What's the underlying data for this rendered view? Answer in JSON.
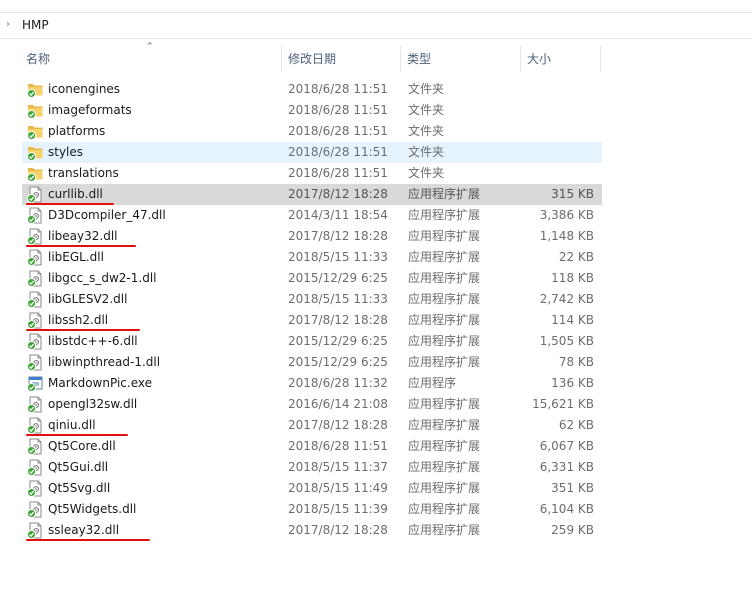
{
  "breadcrumb": {
    "chevron": "chevron-right-icon",
    "path": "HMP"
  },
  "columns": {
    "name": "名称",
    "date": "修改日期",
    "type": "类型",
    "size": "大小"
  },
  "sort": {
    "column": "name",
    "direction": "ascending"
  },
  "files": [
    {
      "name": "iconengines",
      "date": "2018/6/28 11:51",
      "type": "文件夹",
      "size": "",
      "icon": "folder-icon"
    },
    {
      "name": "imageformats",
      "date": "2018/6/28 11:51",
      "type": "文件夹",
      "size": "",
      "icon": "folder-icon"
    },
    {
      "name": "platforms",
      "date": "2018/6/28 11:51",
      "type": "文件夹",
      "size": "",
      "icon": "folder-icon"
    },
    {
      "name": "styles",
      "date": "2018/6/28 11:51",
      "type": "文件夹",
      "size": "",
      "icon": "folder-icon",
      "state": "hover"
    },
    {
      "name": "translations",
      "date": "2018/6/28 11:51",
      "type": "文件夹",
      "size": "",
      "icon": "folder-icon"
    },
    {
      "name": "curllib.dll",
      "date": "2017/8/12 18:28",
      "type": "应用程序扩展",
      "size": "315 KB",
      "icon": "dll-icon",
      "state": "selected",
      "underlined": true
    },
    {
      "name": "D3Dcompiler_47.dll",
      "date": "2014/3/11 18:54",
      "type": "应用程序扩展",
      "size": "3,386 KB",
      "icon": "dll-icon"
    },
    {
      "name": "libeay32.dll",
      "date": "2017/8/12 18:28",
      "type": "应用程序扩展",
      "size": "1,148 KB",
      "icon": "dll-icon",
      "underlined": true
    },
    {
      "name": "libEGL.dll",
      "date": "2018/5/15 11:33",
      "type": "应用程序扩展",
      "size": "22 KB",
      "icon": "dll-icon"
    },
    {
      "name": "libgcc_s_dw2-1.dll",
      "date": "2015/12/29 6:25",
      "type": "应用程序扩展",
      "size": "118 KB",
      "icon": "dll-icon"
    },
    {
      "name": "libGLESV2.dll",
      "date": "2018/5/15 11:33",
      "type": "应用程序扩展",
      "size": "2,742 KB",
      "icon": "dll-icon"
    },
    {
      "name": "libssh2.dll",
      "date": "2017/8/12 18:28",
      "type": "应用程序扩展",
      "size": "114 KB",
      "icon": "dll-icon",
      "underlined": true
    },
    {
      "name": "libstdc++-6.dll",
      "date": "2015/12/29 6:25",
      "type": "应用程序扩展",
      "size": "1,505 KB",
      "icon": "dll-icon"
    },
    {
      "name": "libwinpthread-1.dll",
      "date": "2015/12/29 6:25",
      "type": "应用程序扩展",
      "size": "78 KB",
      "icon": "dll-icon"
    },
    {
      "name": "MarkdownPic.exe",
      "date": "2018/6/28 11:32",
      "type": "应用程序",
      "size": "136 KB",
      "icon": "exe-icon"
    },
    {
      "name": "opengl32sw.dll",
      "date": "2016/6/14 21:08",
      "type": "应用程序扩展",
      "size": "15,621 KB",
      "icon": "dll-icon"
    },
    {
      "name": "qiniu.dll",
      "date": "2017/8/12 18:28",
      "type": "应用程序扩展",
      "size": "62 KB",
      "icon": "dll-icon",
      "underlined": true
    },
    {
      "name": "Qt5Core.dll",
      "date": "2018/6/28 11:51",
      "type": "应用程序扩展",
      "size": "6,067 KB",
      "icon": "dll-icon"
    },
    {
      "name": "Qt5Gui.dll",
      "date": "2018/5/15 11:37",
      "type": "应用程序扩展",
      "size": "6,331 KB",
      "icon": "dll-icon"
    },
    {
      "name": "Qt5Svg.dll",
      "date": "2018/5/15 11:49",
      "type": "应用程序扩展",
      "size": "351 KB",
      "icon": "dll-icon"
    },
    {
      "name": "Qt5Widgets.dll",
      "date": "2018/5/15 11:39",
      "type": "应用程序扩展",
      "size": "6,104 KB",
      "icon": "dll-icon"
    },
    {
      "name": "ssleay32.dll",
      "date": "2017/8/12 18:28",
      "type": "应用程序扩展",
      "size": "259 KB",
      "icon": "dll-icon",
      "underlined": true
    }
  ],
  "colors": {
    "header_text": "#4c607a",
    "hover_bg": "#e5f3ff",
    "selected_bg": "#d9d9d9",
    "annotation": "#e01010",
    "sync_check": "#3aa334"
  }
}
